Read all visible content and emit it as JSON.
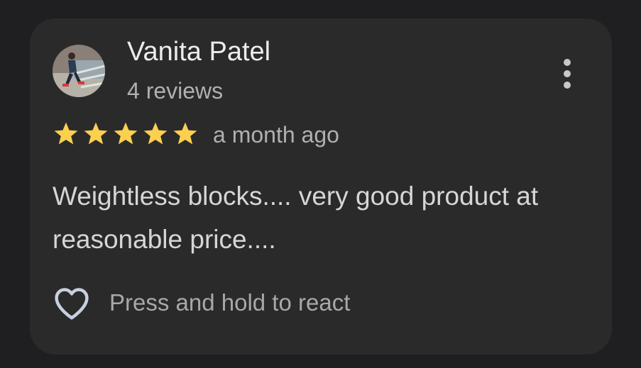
{
  "review": {
    "reviewer_name": "Vanita Patel",
    "review_count": "4 reviews",
    "rating": 5,
    "rating_max": 5,
    "time": "a month ago",
    "text": "Weightless blocks.... very good product at reasonable price....",
    "react_label": "Press and hold to react"
  },
  "icons": {
    "menu": "more-vert-icon",
    "star": "star-icon",
    "heart": "heart-outline-icon"
  },
  "colors": {
    "background": "#1f1f22",
    "card": "#2a2a2b",
    "star": "#fcd04f",
    "primary_text": "#ececec",
    "secondary_text": "#b0b0b0"
  }
}
